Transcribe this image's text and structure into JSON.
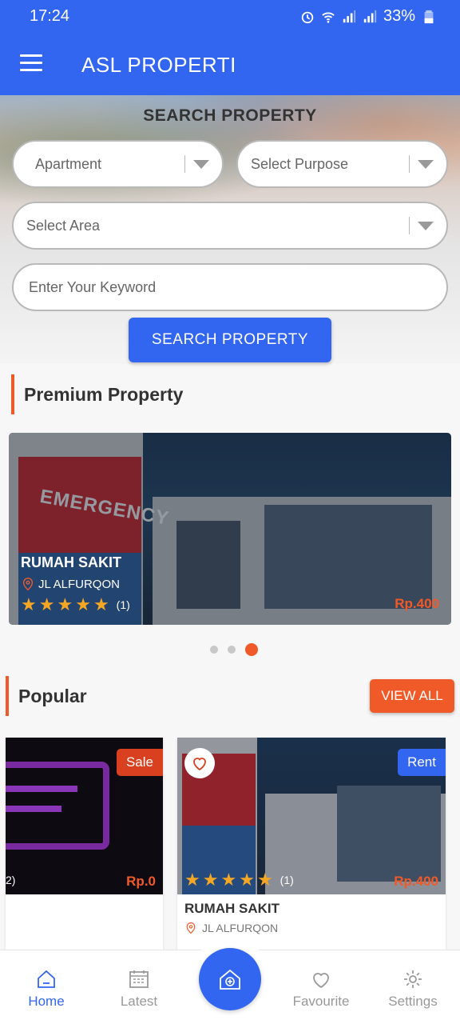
{
  "status_bar": {
    "time": "17:24",
    "battery": "33%"
  },
  "app": {
    "title": "ASL PROPERTI"
  },
  "search": {
    "title": "SEARCH PROPERTY",
    "type_value": "Apartment",
    "purpose_placeholder": "Select Purpose",
    "area_placeholder": "Select Area",
    "keyword_placeholder": "Enter Your Keyword",
    "button_label": "SEARCH PROPERTY"
  },
  "premium": {
    "section_title": "Premium Property",
    "card": {
      "name": "RUMAH SAKIT",
      "location": "JL ALFURQON",
      "rating": 5,
      "rating_count": "(1)",
      "price": "Rp.400"
    },
    "slider": {
      "count": 3,
      "active_index": 2
    }
  },
  "popular": {
    "section_title": "Popular",
    "view_all_label": "VIEW ALL",
    "cards": [
      {
        "tag": "Sale",
        "price": "Rp.0",
        "partial_count": "2)"
      },
      {
        "tag": "Rent",
        "price": "Rp.400",
        "name": "RUMAH SAKIT",
        "location": "JL ALFURQON",
        "rating": 5,
        "rating_count": "(1)"
      }
    ]
  },
  "bottom_nav": {
    "items": [
      {
        "label": "Home",
        "icon": "home-icon",
        "active": true
      },
      {
        "label": "Latest",
        "icon": "calendar-icon",
        "active": false
      },
      {
        "label": "Favourite",
        "icon": "heart-icon",
        "active": false
      },
      {
        "label": "Settings",
        "icon": "gear-icon",
        "active": false
      }
    ],
    "center_icon": "add-property-icon"
  },
  "colors": {
    "primary": "#3366f0",
    "accent": "#f05a28",
    "star": "#f5a623",
    "rent_tag": "#3366f0",
    "sale_tag": "#d9401f"
  }
}
